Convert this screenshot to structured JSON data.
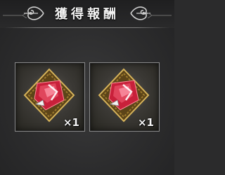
{
  "header": {
    "title": "獲得報酬"
  },
  "rewards": [
    {
      "icon": "red-gem-fragment-icon",
      "quantity": "×1"
    },
    {
      "icon": "red-gem-fragment-icon",
      "quantity": "×1"
    }
  ],
  "colors": {
    "background": "#2b2b2c",
    "gem": "#c8203a",
    "gold_frame": "#b8913c",
    "text": "#f2f2f2"
  }
}
